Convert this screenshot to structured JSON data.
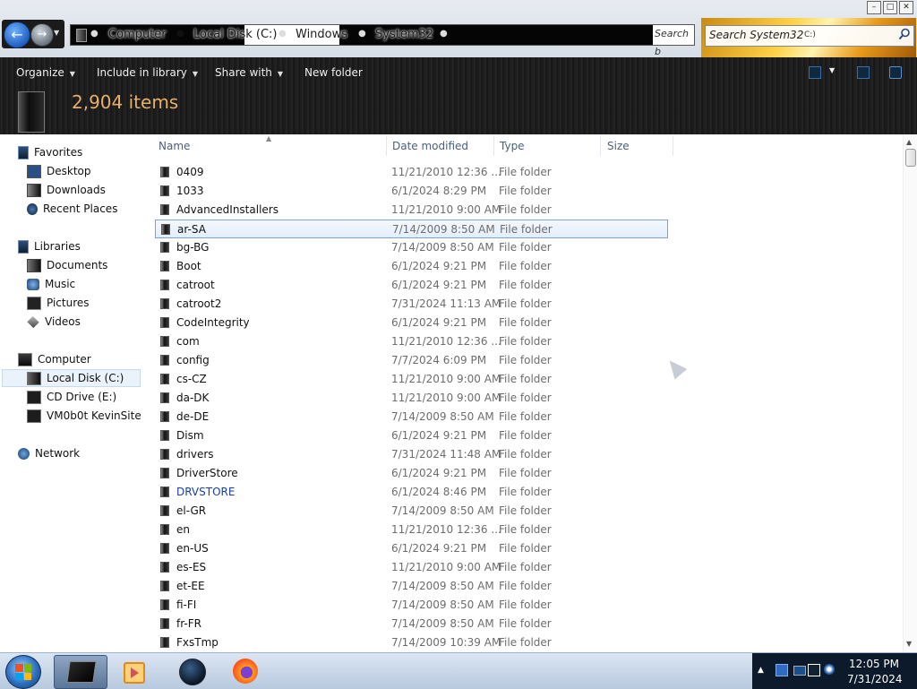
{
  "window": {
    "controls": [
      "minimize",
      "maximize",
      "close"
    ]
  },
  "address": {
    "crumbs": [
      "Computer",
      "Local Disk (C:)",
      "Windows",
      "System32"
    ],
    "search_mini": "Search b",
    "search_placeholder": "Search System32",
    "search_overlay": "C:)"
  },
  "toolbar": {
    "organize": "Organize",
    "include": "Include in library",
    "share": "Share with",
    "new_folder": "New folder",
    "item_count": "2,904 items"
  },
  "nav": {
    "favorites": "Favorites",
    "desktop": "Desktop",
    "downloads": "Downloads",
    "recent": "Recent Places",
    "libraries": "Libraries",
    "documents": "Documents",
    "music": "Music",
    "pictures": "Pictures",
    "videos": "Videos",
    "computer": "Computer",
    "local_disk": "Local Disk (C:)",
    "cd_drive": "CD Drive (E:)",
    "share": "VM0b0t KevinSite",
    "network": "Network"
  },
  "columns": {
    "name": "Name",
    "date": "Date modified",
    "type": "Type",
    "size": "Size"
  },
  "files": [
    {
      "name": "0409",
      "date": "11/21/2010 12:36 ...",
      "type": "File folder"
    },
    {
      "name": "1033",
      "date": "6/1/2024 8:29 PM",
      "type": "File folder"
    },
    {
      "name": "AdvancedInstallers",
      "date": "11/21/2010 9:00 AM",
      "type": "File folder"
    },
    {
      "name": "ar-SA",
      "date": "7/14/2009 8:50 AM",
      "type": "File folder"
    },
    {
      "name": "bg-BG",
      "date": "7/14/2009 8:50 AM",
      "type": "File folder"
    },
    {
      "name": "Boot",
      "date": "6/1/2024 9:21 PM",
      "type": "File folder"
    },
    {
      "name": "catroot",
      "date": "6/1/2024 9:21 PM",
      "type": "File folder"
    },
    {
      "name": "catroot2",
      "date": "7/31/2024 11:13 AM",
      "type": "File folder"
    },
    {
      "name": "CodeIntegrity",
      "date": "6/1/2024 9:21 PM",
      "type": "File folder"
    },
    {
      "name": "com",
      "date": "11/21/2010 12:36 ...",
      "type": "File folder"
    },
    {
      "name": "config",
      "date": "7/7/2024 6:09 PM",
      "type": "File folder"
    },
    {
      "name": "cs-CZ",
      "date": "11/21/2010 9:00 AM",
      "type": "File folder"
    },
    {
      "name": "da-DK",
      "date": "11/21/2010 9:00 AM",
      "type": "File folder"
    },
    {
      "name": "de-DE",
      "date": "7/14/2009 8:50 AM",
      "type": "File folder"
    },
    {
      "name": "Dism",
      "date": "6/1/2024 9:21 PM",
      "type": "File folder"
    },
    {
      "name": "drivers",
      "date": "7/31/2024 11:48 AM",
      "type": "File folder"
    },
    {
      "name": "DriverStore",
      "date": "6/1/2024 9:21 PM",
      "type": "File folder"
    },
    {
      "name": "DRVSTORE",
      "date": "6/1/2024 8:46 PM",
      "type": "File folder"
    },
    {
      "name": "el-GR",
      "date": "7/14/2009 8:50 AM",
      "type": "File folder"
    },
    {
      "name": "en",
      "date": "11/21/2010 12:36 ...",
      "type": "File folder"
    },
    {
      "name": "en-US",
      "date": "6/1/2024 9:21 PM",
      "type": "File folder"
    },
    {
      "name": "es-ES",
      "date": "11/21/2010 9:00 AM",
      "type": "File folder"
    },
    {
      "name": "et-EE",
      "date": "7/14/2009 8:50 AM",
      "type": "File folder"
    },
    {
      "name": "fi-FI",
      "date": "7/14/2009 8:50 AM",
      "type": "File folder"
    },
    {
      "name": "fr-FR",
      "date": "7/14/2009 8:50 AM",
      "type": "File folder"
    },
    {
      "name": "FxsTmp",
      "date": "7/14/2009 10:39 AM",
      "type": "File folder"
    }
  ],
  "highlighted_file": "ar-SA",
  "compressed_file": "DRVSTORE",
  "taskbar": {
    "time": "12:05 PM",
    "date": "7/31/2024"
  },
  "colors": {
    "accent_text": "#e7b06a",
    "compressed_name": "#1a3fa8",
    "header_bg": "#1a1a1a"
  }
}
